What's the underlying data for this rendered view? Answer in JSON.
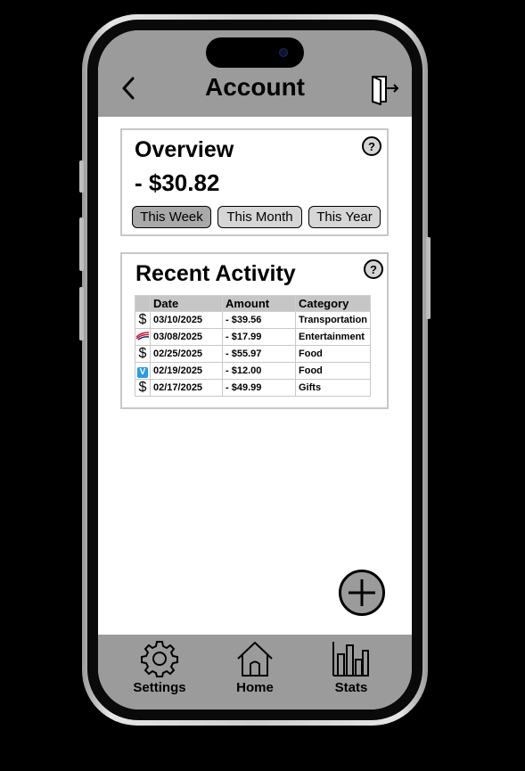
{
  "header": {
    "title": "Account"
  },
  "overview": {
    "title": "Overview",
    "balance": "- $30.82",
    "ranges": [
      "This Week",
      "This Month",
      "This Year"
    ],
    "selected_range": "This Week"
  },
  "activity": {
    "title": "Recent Activity",
    "columns": [
      "Date",
      "Amount",
      "Category"
    ],
    "rows": [
      {
        "source": "$",
        "date": "03/10/2025",
        "amount": "- $39.56",
        "category": "Transportation"
      },
      {
        "source": "bank-of-america-icon",
        "date": "03/08/2025",
        "amount": "- $17.99",
        "category": "Entertainment"
      },
      {
        "source": "$",
        "date": "02/25/2025",
        "amount": "- $55.97",
        "category": "Food"
      },
      {
        "source": "V",
        "date": "02/19/2025",
        "amount": "- $12.00",
        "category": "Food"
      },
      {
        "source": "$",
        "date": "02/17/2025",
        "amount": "- $49.99",
        "category": "Gifts"
      }
    ]
  },
  "nav": {
    "items": [
      {
        "label": "Settings",
        "icon": "gear-icon"
      },
      {
        "label": "Home",
        "icon": "home-icon"
      },
      {
        "label": "Stats",
        "icon": "bar-chart-icon"
      }
    ]
  },
  "colors": {
    "bar_gray": "#9b9b9b",
    "active_range": "#a9a9a9",
    "venmo_blue": "#2a9be8"
  }
}
